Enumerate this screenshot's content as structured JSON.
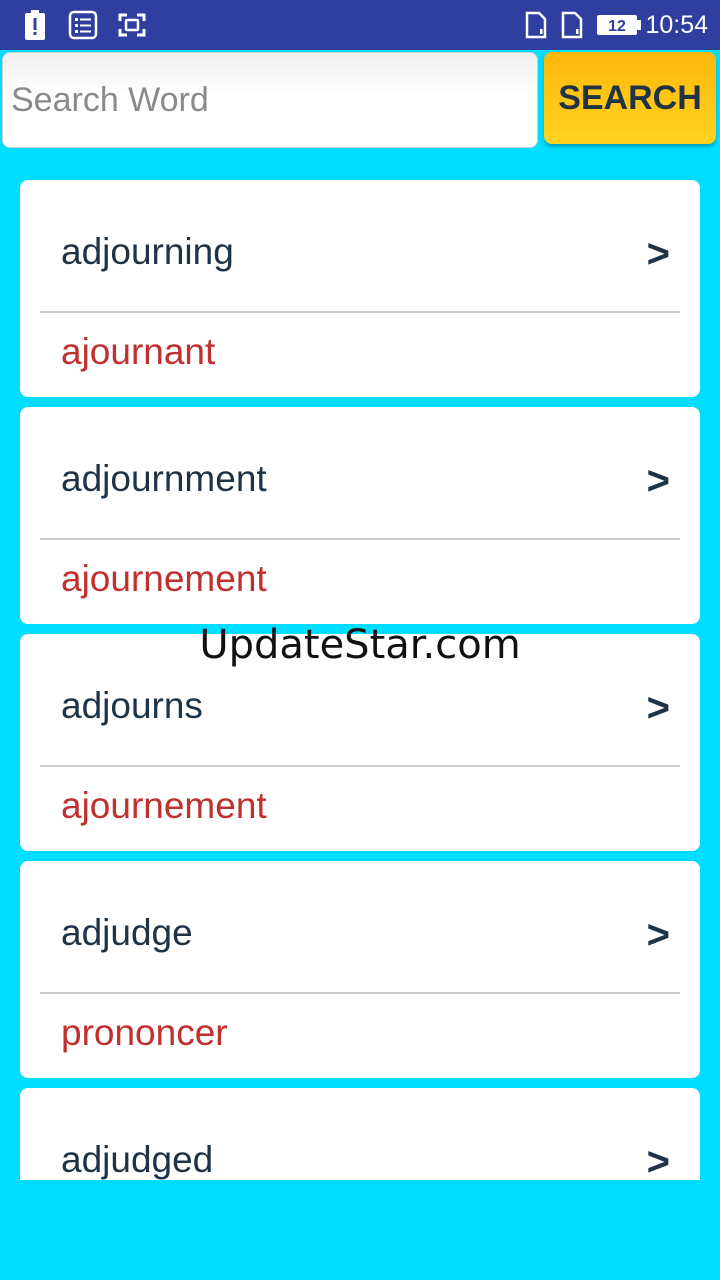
{
  "status_bar": {
    "time": "10:54",
    "battery_level": "12",
    "icons": [
      "alert-battery-icon",
      "checklist-icon",
      "screenshot-icon",
      "sim-card-icon",
      "sim-card-icon",
      "battery-icon"
    ]
  },
  "search": {
    "placeholder": "Search Word",
    "value": "",
    "button_label": "SEARCH"
  },
  "results": [
    {
      "word": "adjourning",
      "translation": "ajournant",
      "arrow": ">"
    },
    {
      "word": "adjournment",
      "translation": "ajournement",
      "arrow": ">"
    },
    {
      "word": "adjourns",
      "translation": "ajournement",
      "arrow": ">"
    },
    {
      "word": "adjudge",
      "translation": "prononcer",
      "arrow": ">"
    },
    {
      "word": "adjudged",
      "translation": "",
      "arrow": ">"
    }
  ],
  "watermark": "UpdateStar.com",
  "colors": {
    "background": "#00DDFF",
    "status_bar": "#303F9F",
    "search_button": "#FFC414",
    "word_text": "#1F3347",
    "translation_text": "#C0302E"
  }
}
